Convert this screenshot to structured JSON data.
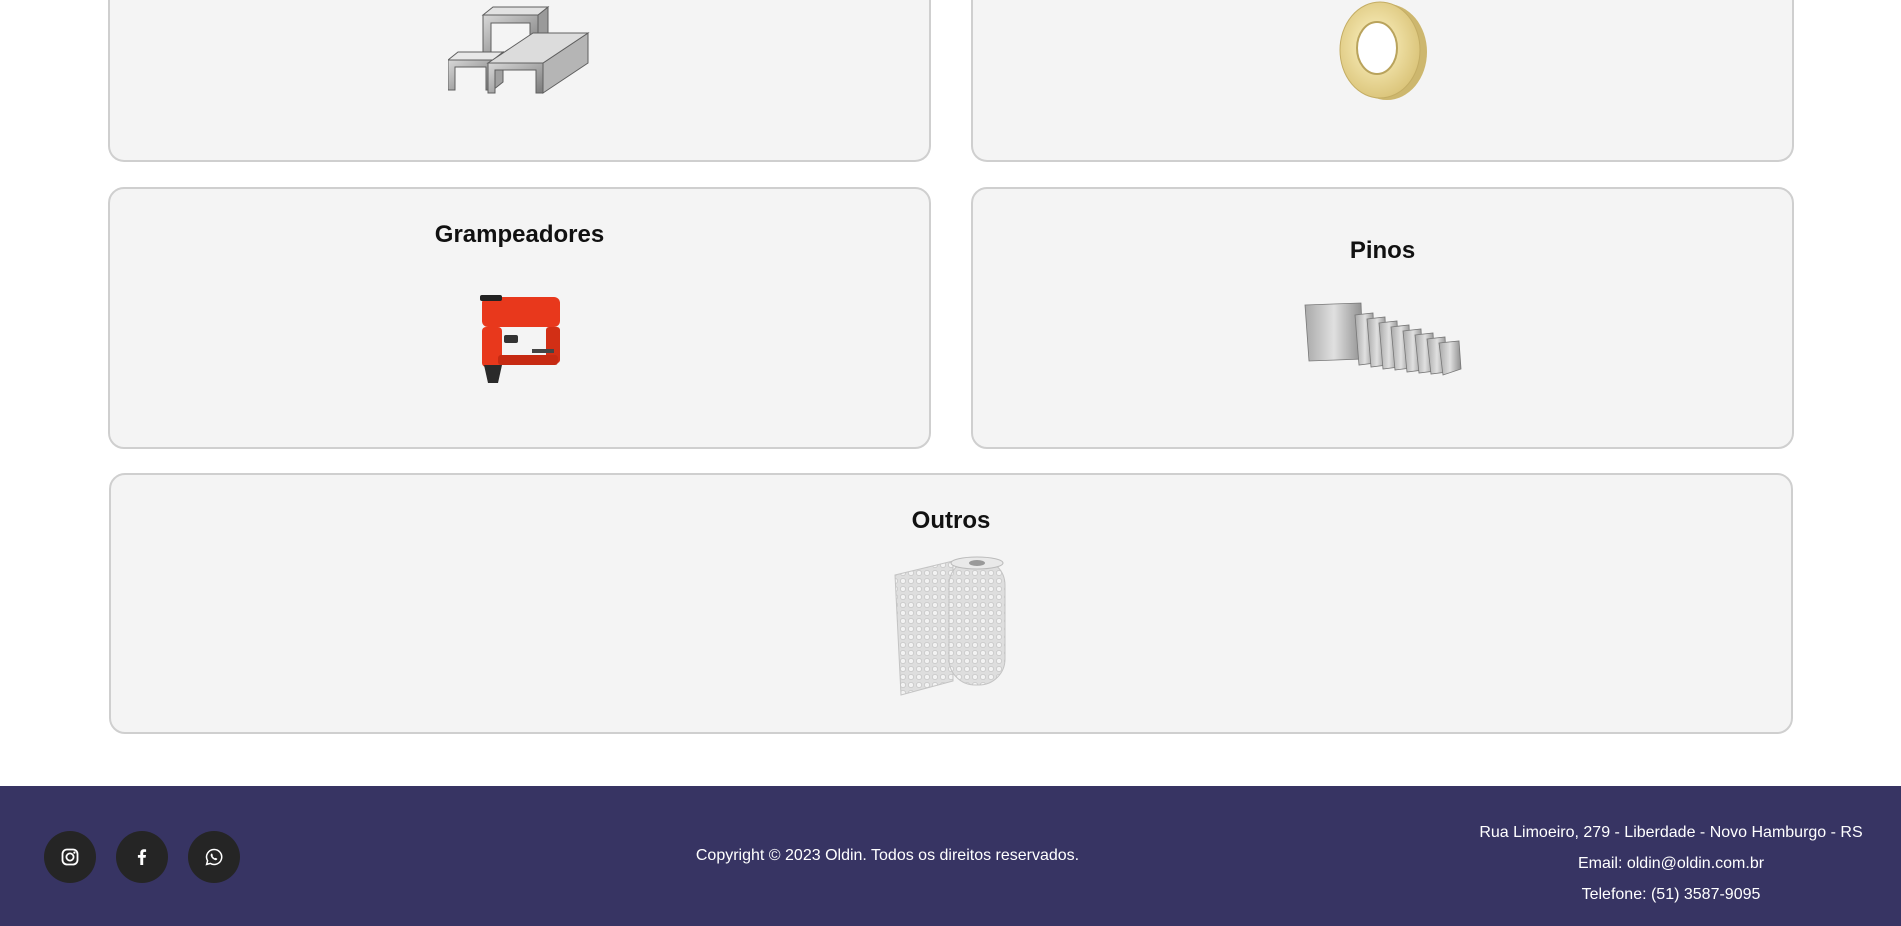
{
  "categories": {
    "grampeadores": {
      "title": "Grampeadores",
      "image": "red-stapler-gun-image"
    },
    "pinos": {
      "title": "Pinos",
      "image": "brad-nails-strips-image"
    },
    "outros": {
      "title": "Outros",
      "image": "bubble-wrap-roll-image"
    },
    "grampos_partial": {
      "image": "staples-strips-image"
    },
    "fitas_partial": {
      "image": "clear-tape-roll-image"
    }
  },
  "footer": {
    "social": [
      {
        "icon": "instagram-icon"
      },
      {
        "icon": "facebook-icon"
      },
      {
        "icon": "whatsapp-icon"
      }
    ],
    "copyright": "Copyright © 2023 Oldin. Todos os direitos reservados.",
    "address": "Rua Limoeiro, 279 - Liberdade - Novo Hamburgo - RS",
    "email": "Email: oldin@oldin.com.br",
    "phone": "Telefone: (51) 3587-9095"
  },
  "colors": {
    "footer_bg": "#373463",
    "card_bg": "#f4f4f4",
    "card_border": "#cfcfcf",
    "social_bg": "#252525",
    "stapler_red": "#e8381c"
  }
}
